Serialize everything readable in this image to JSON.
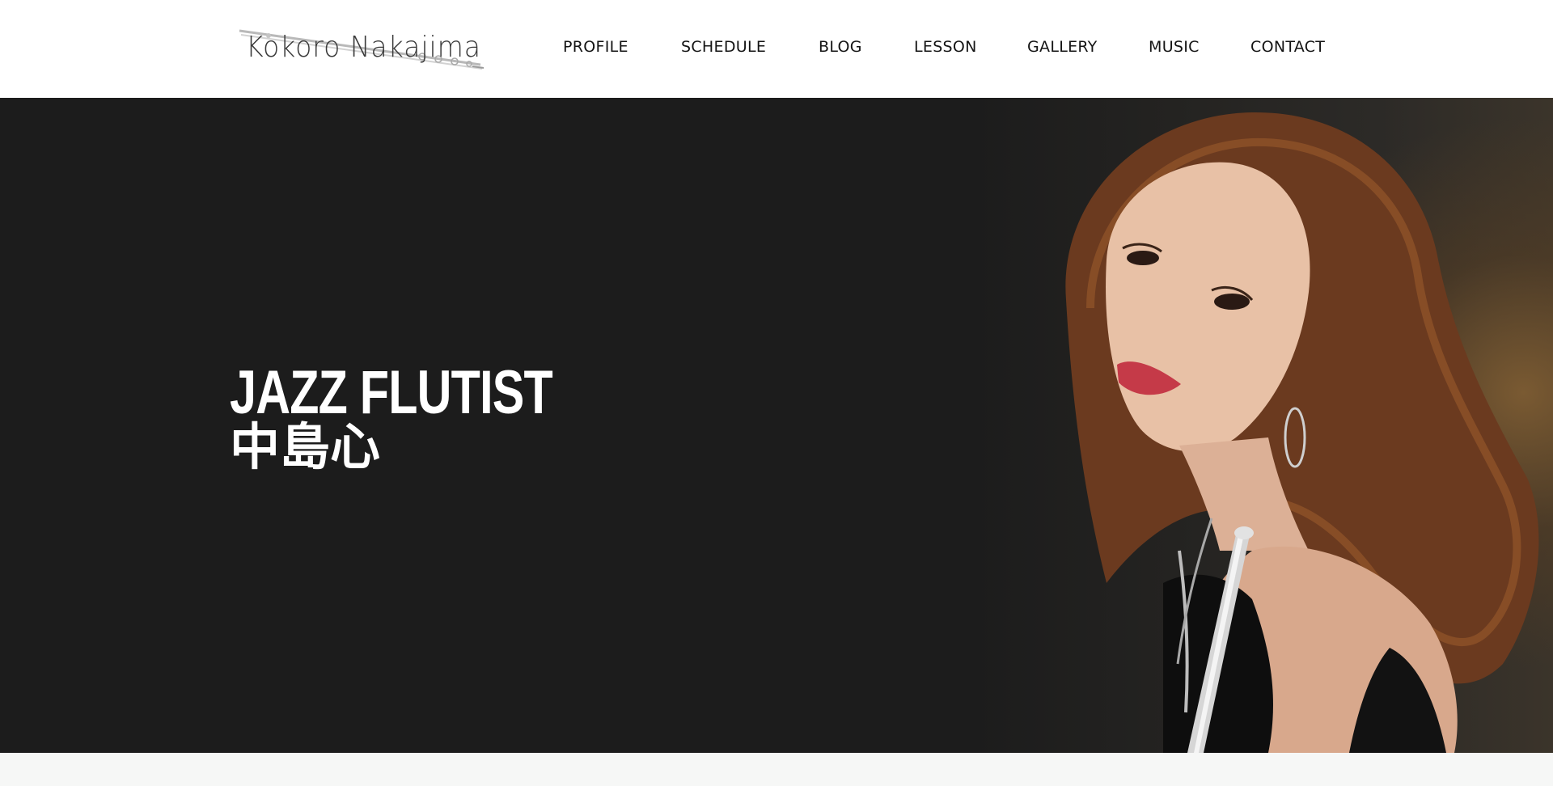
{
  "site": {
    "logo_text": "Kokoro Nakajima"
  },
  "nav": {
    "items": [
      {
        "label": "PROFILE"
      },
      {
        "label": "SCHEDULE"
      },
      {
        "label": "BLOG"
      },
      {
        "label": "LESSON"
      },
      {
        "label": "GALLERY"
      },
      {
        "label": "MUSIC"
      },
      {
        "label": "CONTACT"
      }
    ]
  },
  "hero": {
    "title_en": "JAZZ FLUTIST",
    "title_ja": "中島心",
    "photo_icon": "portrait-photo"
  },
  "colors": {
    "hero_background": "#1c1c1c",
    "header_background": "#ffffff",
    "nav_text": "#141414",
    "hero_text": "#ffffff",
    "page_background": "#f6f7f6"
  }
}
